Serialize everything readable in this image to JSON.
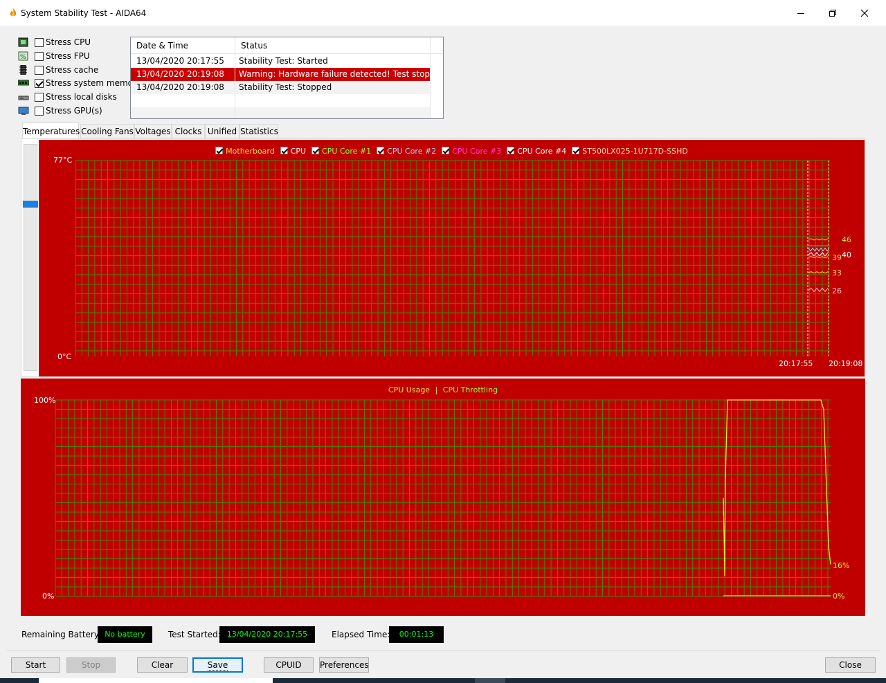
{
  "window": {
    "title": "System Stability Test - AIDA64"
  },
  "stress": [
    {
      "label": "Stress CPU",
      "checked": false,
      "icon": "cpu-icon"
    },
    {
      "label": "Stress FPU",
      "checked": false,
      "icon": "fpu-icon"
    },
    {
      "label": "Stress cache",
      "checked": false,
      "icon": "cache-icon"
    },
    {
      "label": "Stress system memory",
      "checked": true,
      "icon": "memory-icon"
    },
    {
      "label": "Stress local disks",
      "checked": false,
      "icon": "disk-icon"
    },
    {
      "label": "Stress GPU(s)",
      "checked": false,
      "icon": "gpu-icon"
    }
  ],
  "log": {
    "headers": [
      "Date & Time",
      "Status"
    ],
    "rows": [
      {
        "date": "13/04/2020 20:17:55",
        "status": "Stability Test: Started"
      },
      {
        "date": "13/04/2020 20:19:08",
        "status": "Warning: Hardware failure detected! Test stopped"
      },
      {
        "date": "13/04/2020 20:19:08",
        "status": "Stability Test: Stopped"
      }
    ]
  },
  "tabs": [
    "Temperatures",
    "Cooling Fans",
    "Voltages",
    "Clocks",
    "Unified",
    "Statistics"
  ],
  "temp_chart": {
    "legend": [
      {
        "label": "Motherboard",
        "color": "#ffd84a"
      },
      {
        "label": "CPU",
        "color": "#ffffff"
      },
      {
        "label": "CPU Core #1",
        "color": "#8cff3c"
      },
      {
        "label": "CPU Core #2",
        "color": "#a8d8ff"
      },
      {
        "label": "CPU Core #3",
        "color": "#ff3cc8"
      },
      {
        "label": "CPU Core #4",
        "color": "#ffffff"
      },
      {
        "label": "ST500LX025-1U717D-SSHD",
        "color": "#ffd8b0"
      }
    ],
    "y_max_label": "77°C",
    "y_min_label": "0°C",
    "x_labels": [
      "20:17:55",
      "20:19:08"
    ],
    "value_labels": [
      {
        "text": "46",
        "color": "#8cff3c"
      },
      {
        "text": "40",
        "color": "#ffffff"
      },
      {
        "text": "39",
        "color": "#ffd84a"
      },
      {
        "text": "33",
        "color": "#ffd84a"
      },
      {
        "text": "26",
        "color": "#ffc0c0"
      }
    ]
  },
  "cpu_chart": {
    "legend_usage": "CPU Usage",
    "legend_sep": "|",
    "legend_throttle": "CPU Throttling",
    "y_max_label": "100%",
    "y_min_label": "0%",
    "value_usage": "16%",
    "value_throttle": "0%"
  },
  "chart_data": [
    {
      "type": "line",
      "title": "",
      "ylim": [
        0,
        77
      ],
      "x": [
        "20:17:55",
        "20:19:08"
      ],
      "series": [
        {
          "name": "CPU Core #1",
          "values": [
            46,
            46
          ]
        },
        {
          "name": "CPU",
          "values": [
            40,
            40
          ]
        },
        {
          "name": "Motherboard",
          "values": [
            39,
            39
          ]
        },
        {
          "name": "ST500LX025-1U717D-SSHD",
          "values": [
            33,
            33
          ]
        },
        {
          "name": "CPU Core #4",
          "values": [
            26,
            26
          ]
        }
      ]
    },
    {
      "type": "line",
      "title": "",
      "ylim": [
        0,
        100
      ],
      "series": [
        {
          "name": "CPU Usage",
          "values": [
            16
          ]
        },
        {
          "name": "CPU Throttling",
          "values": [
            0
          ]
        }
      ]
    }
  ],
  "status": {
    "battery_label": "Remaining Battery:",
    "battery_value": "No battery",
    "started_label": "Test Started:",
    "started_value": "13/04/2020 20:17:55",
    "elapsed_label": "Elapsed Time:",
    "elapsed_value": "00:01:13"
  },
  "buttons": {
    "start": "Start",
    "stop": "Stop",
    "clear": "Clear",
    "save": "Save",
    "cpuid": "CPUID",
    "preferences": "Preferences",
    "close": "Close"
  },
  "colors": {
    "chart_bg": "#c00000",
    "grid": "#3f8a00",
    "usage_line": "#e8e840"
  }
}
